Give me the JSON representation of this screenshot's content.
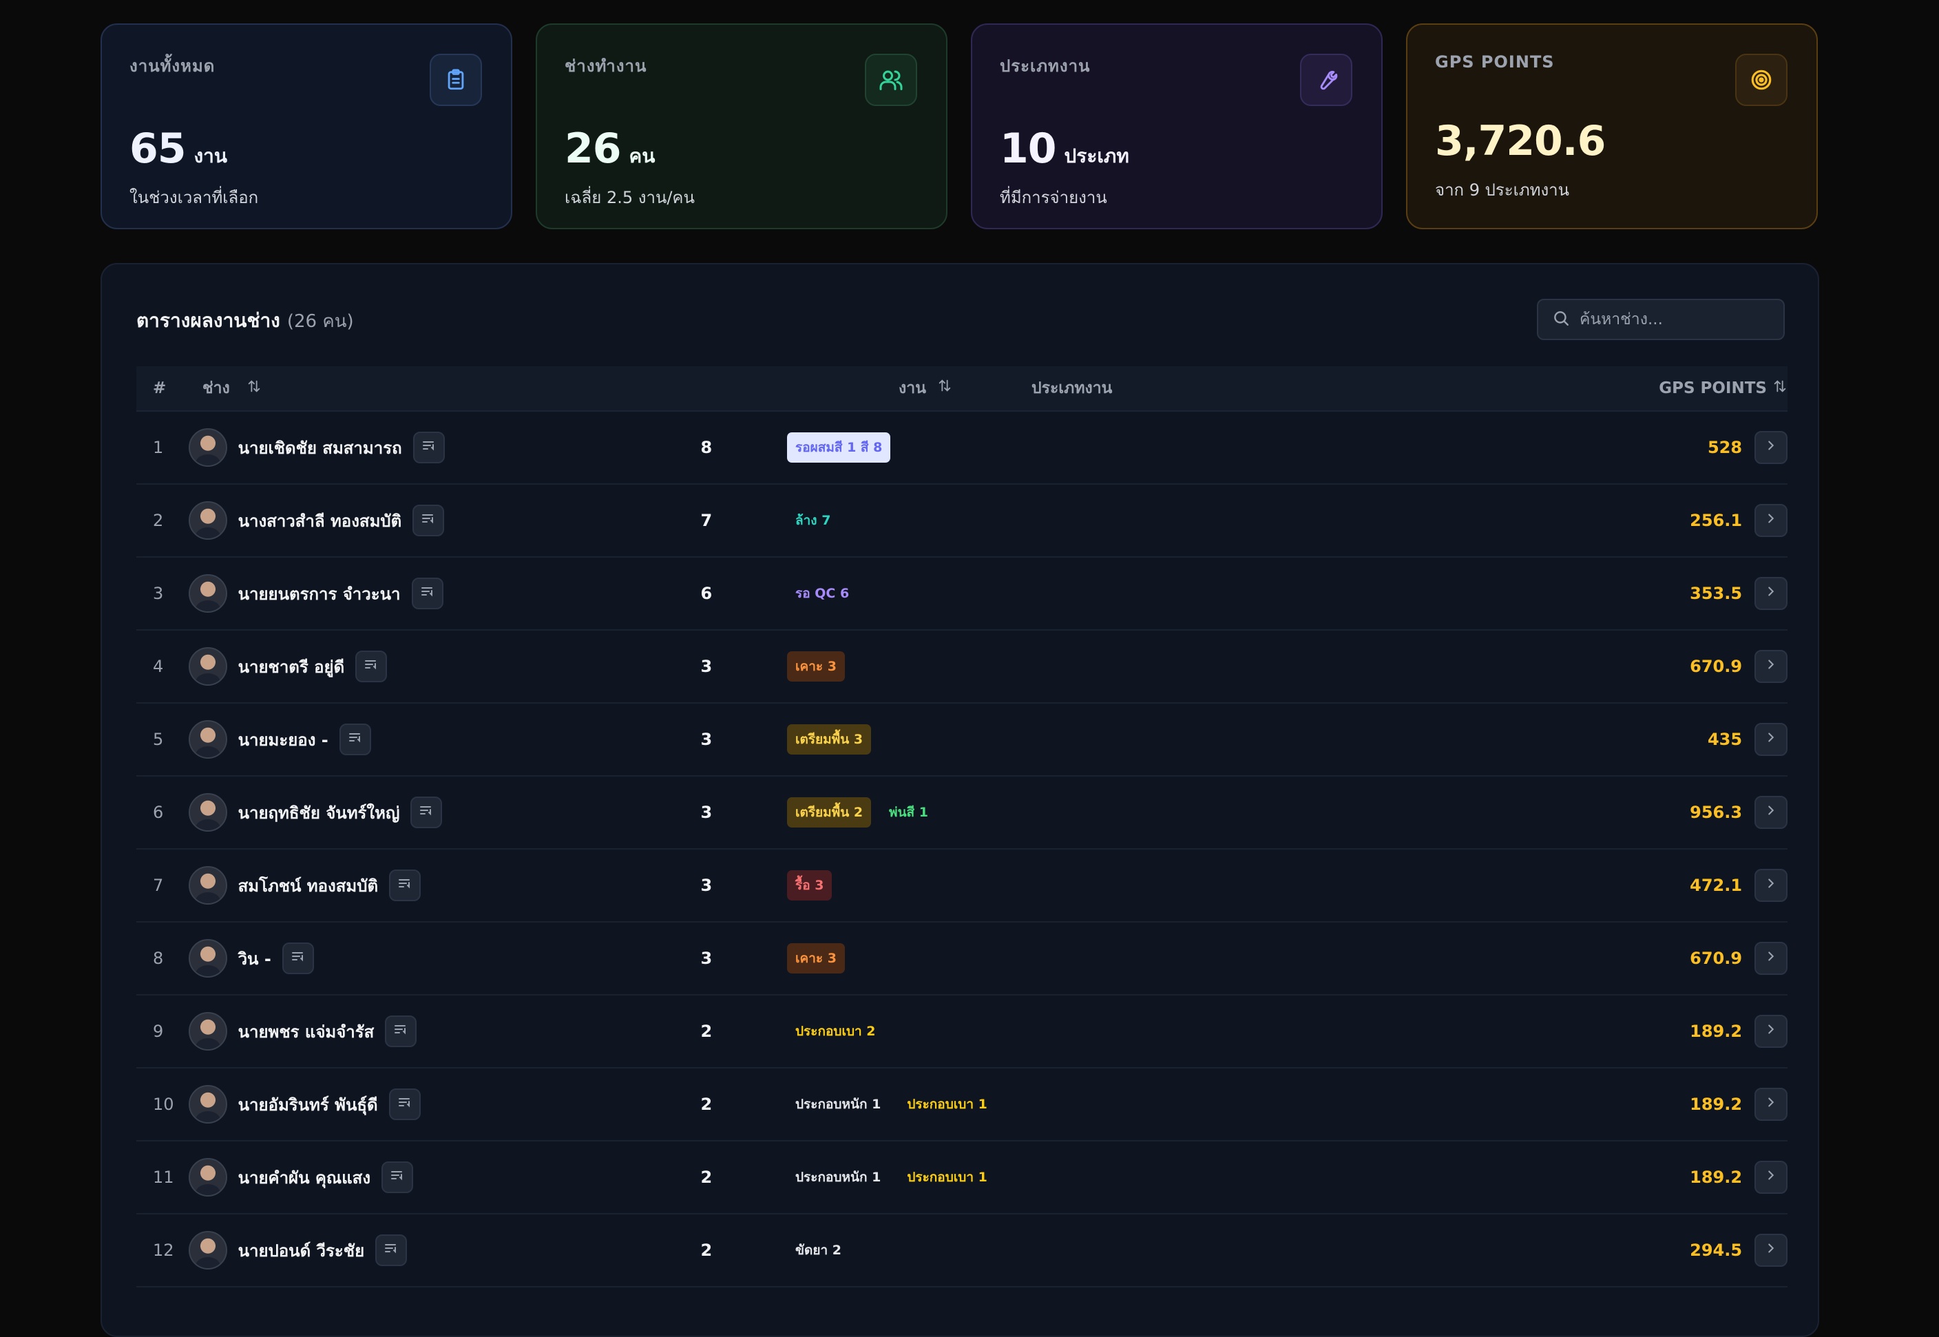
{
  "cards": [
    {
      "label": "งานทั้งหมด",
      "value": "65",
      "unit": "งาน",
      "sub": "ในช่วงเวลาที่เลือก",
      "icon": "clipboard-icon",
      "accent": "#60a5fa"
    },
    {
      "label": "ช่างทำงาน",
      "value": "26",
      "unit": "คน",
      "sub": "เฉลี่ย 2.5 งาน/คน",
      "icon": "users-icon",
      "accent": "#34d399"
    },
    {
      "label": "ประเภทงาน",
      "value": "10",
      "unit": "ประเภท",
      "sub": "ที่มีการจ่ายงาน",
      "icon": "wrench-icon",
      "accent": "#a78bfa"
    },
    {
      "label": "GPS POINTS",
      "value": "3,720.6",
      "unit": "",
      "sub": "จาก 9 ประเภทงาน",
      "icon": "target-icon",
      "accent": "#fbbf24"
    }
  ],
  "table": {
    "title": "ตารางผลงานช่าง",
    "count": "(26 คน)",
    "search_placeholder": "ค้นหาช่าง...",
    "headers": {
      "num": "#",
      "name": "ช่าง",
      "jobs": "งาน",
      "types": "ประเภทงาน",
      "gps": "GPS POINTS"
    },
    "rows": [
      {
        "num": "1",
        "name": "นายเชิดชัย สมสามารถ",
        "jobs": "8",
        "badges": [
          {
            "text": "รอผสมสี 1 สี 8",
            "bg": "#e0e7ff",
            "fg": "#6366f1"
          }
        ],
        "gps": "528"
      },
      {
        "num": "2",
        "name": "นางสาวสำลี ทองสมบัติ",
        "jobs": "7",
        "badges": [
          {
            "text": "ล้าง 7",
            "bg": "transparent",
            "fg": "#2dd4bf"
          }
        ],
        "gps": "256.1"
      },
      {
        "num": "3",
        "name": "นายยนตรการ จำวะนา",
        "jobs": "6",
        "badges": [
          {
            "text": "รอ QC 6",
            "bg": "transparent",
            "fg": "#a78bfa"
          }
        ],
        "gps": "353.5"
      },
      {
        "num": "4",
        "name": "นายชาตรี อยู่ดี",
        "jobs": "3",
        "badges": [
          {
            "text": "เคาะ 3",
            "bg": "#4a2a17",
            "fg": "#fb923c"
          }
        ],
        "gps": "670.9"
      },
      {
        "num": "5",
        "name": "นายมะยอง -",
        "jobs": "3",
        "badges": [
          {
            "text": "เตรียมพื้น 3",
            "bg": "#4a3b12",
            "fg": "#fcd34d"
          }
        ],
        "gps": "435"
      },
      {
        "num": "6",
        "name": "นายฤทธิชัย จันทร์ใหญ่",
        "jobs": "3",
        "badges": [
          {
            "text": "เตรียมพื้น 2",
            "bg": "#4a3b12",
            "fg": "#fcd34d"
          },
          {
            "text": "พ่นสี 1",
            "bg": "transparent",
            "fg": "#4ade80"
          }
        ],
        "gps": "956.3"
      },
      {
        "num": "7",
        "name": "สมโภชน์ ทองสมบัติ",
        "jobs": "3",
        "badges": [
          {
            "text": "รื้อ 3",
            "bg": "#4a1d22",
            "fg": "#f87171"
          }
        ],
        "gps": "472.1"
      },
      {
        "num": "8",
        "name": "วิน -",
        "jobs": "3",
        "badges": [
          {
            "text": "เคาะ 3",
            "bg": "#4a2a17",
            "fg": "#fb923c"
          }
        ],
        "gps": "670.9"
      },
      {
        "num": "9",
        "name": "นายพชร แจ่มจำรัส",
        "jobs": "2",
        "badges": [
          {
            "text": "ประกอบเบา 2",
            "bg": "transparent",
            "fg": "#facc15"
          }
        ],
        "gps": "189.2"
      },
      {
        "num": "10",
        "name": "นายอัมรินทร์ พันธุ์ดี",
        "jobs": "2",
        "badges": [
          {
            "text": "ประกอบหนัก 1",
            "bg": "transparent",
            "fg": "#e5e7eb"
          },
          {
            "text": "ประกอบเบา 1",
            "bg": "transparent",
            "fg": "#facc15"
          }
        ],
        "gps": "189.2"
      },
      {
        "num": "11",
        "name": "นายคำผัน คุณแสง",
        "jobs": "2",
        "badges": [
          {
            "text": "ประกอบหนัก 1",
            "bg": "transparent",
            "fg": "#e5e7eb"
          },
          {
            "text": "ประกอบเบา 1",
            "bg": "transparent",
            "fg": "#facc15"
          }
        ],
        "gps": "189.2"
      },
      {
        "num": "12",
        "name": "นายปอนด์ วีระชัย",
        "jobs": "2",
        "badges": [
          {
            "text": "ขัดยา 2",
            "bg": "transparent",
            "fg": "#e5e7eb"
          }
        ],
        "gps": "294.5"
      }
    ]
  }
}
